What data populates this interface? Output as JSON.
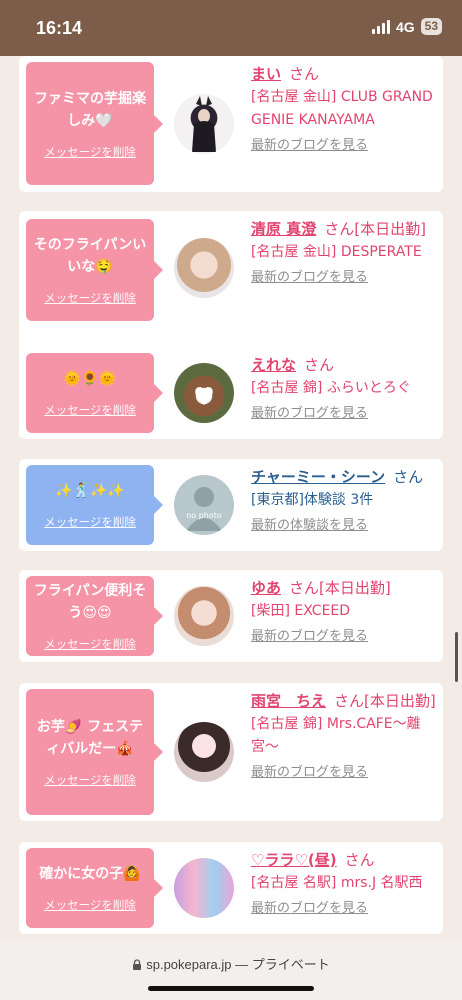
{
  "status": {
    "time": "16:14",
    "network": "4G",
    "battery": "53"
  },
  "items": [
    {
      "message": "ファミマの芋掘楽しみ🤍",
      "delete": "メッセージを削除",
      "name": "まい",
      "honorific": "さん",
      "badge": "",
      "shop": "[名古屋 金山] CLUB GRAND GENIE KANAYAMA",
      "blog": "最新のブログを見る"
    },
    {
      "message": "そのフライパンいいな🤤",
      "delete": "メッセージを削除",
      "name": "清原 真澄",
      "honorific": "さん",
      "badge": "[本日出勤]",
      "shop": "[名古屋 金山] DESPERATE",
      "blog": "最新のブログを見る"
    },
    {
      "message": "🌞🌻🌞",
      "delete": "メッセージを削除",
      "name": "えれな",
      "honorific": "さん",
      "badge": "",
      "shop": "[名古屋 錦] ふらいとろぐ",
      "blog": "最新のブログを見る"
    },
    {
      "message": "✨🕺✨✨",
      "delete": "メッセージを削除",
      "name": "チャーミー・シーン",
      "honorific": "さん",
      "badge": "",
      "shop": "[東京都]体験談 3件",
      "blog": "最新の体験談を見る",
      "no_photo": "no photo"
    },
    {
      "message": "フライパン便利そう😍😍",
      "delete": "メッセージを削除",
      "name": "ゆあ",
      "honorific": "さん",
      "badge": "[本日出勤]",
      "shop": "[柴田] EXCEED",
      "blog": "最新のブログを見る"
    },
    {
      "message": "お芋🍠 フェスティバルだー🎪",
      "delete": "メッセージを削除",
      "name": "雨宮　ちえ",
      "honorific": "さん",
      "badge": "[本日出勤]",
      "shop": "[名古屋 錦] Mrs.CAFE〜離宮〜",
      "blog": "最新のブログを見る"
    },
    {
      "message": "確かに女の子🙆",
      "delete": "メッセージを削除",
      "name": "♡ララ♡(昼)",
      "honorific": "さん",
      "badge": "",
      "shop": "[名古屋 名駅] mrs.J 名駅西",
      "blog": "最新のブログを見る"
    }
  ],
  "browser": {
    "url": "sp.pokepara.jp",
    "mode": "— プライベート"
  }
}
